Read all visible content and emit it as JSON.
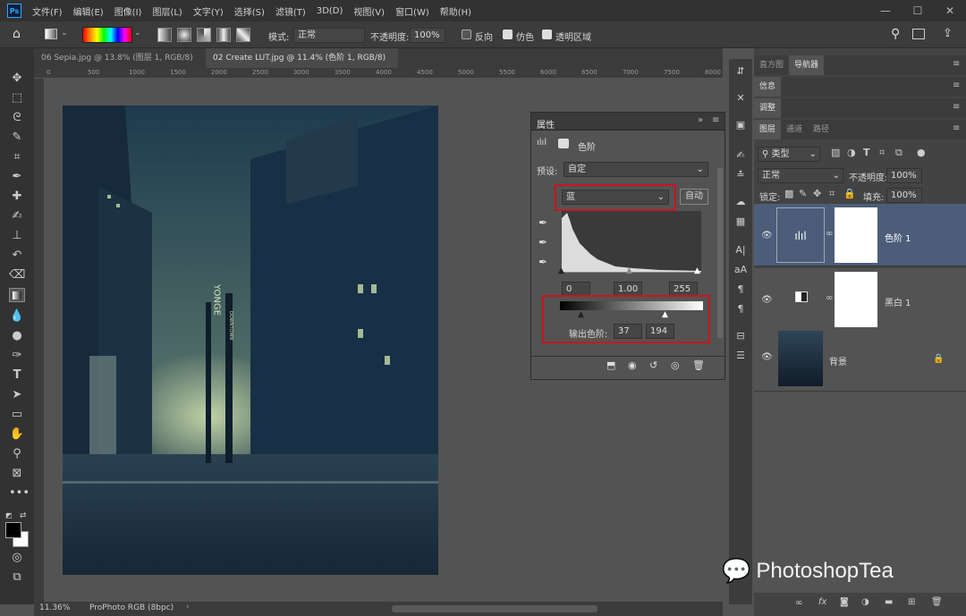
{
  "menu": [
    "文件(F)",
    "编辑(E)",
    "图像(I)",
    "图层(L)",
    "文字(Y)",
    "选择(S)",
    "滤镜(T)",
    "3D(D)",
    "视图(V)",
    "窗口(W)",
    "帮助(H)"
  ],
  "window_controls": {
    "min": "—",
    "max": "☐",
    "close": "✕"
  },
  "options": {
    "mode_label": "模式:",
    "mode_value": "正常",
    "opacity_label": "不透明度:",
    "opacity_value": "100%",
    "reverse_label": "反向",
    "dither_label": "仿色",
    "transparency_label": "透明区域"
  },
  "tabs": [
    {
      "label": "06 Sepia.jpg @ 13.8% (图层 1, RGB/8) *",
      "active": false
    },
    {
      "label": "02 Create LUT.jpg @ 11.4% (色阶 1, RGB/8) *",
      "active": true
    }
  ],
  "ruler_ticks": [
    "0",
    "500",
    "1000",
    "1500",
    "2000",
    "2500",
    "3000",
    "3500",
    "4000",
    "4500",
    "5000",
    "5500",
    "6000",
    "6500",
    "7000",
    "7500",
    "8000"
  ],
  "status": {
    "zoom": "11.36%",
    "profile": "ProPhoto RGB (8bpc)"
  },
  "properties": {
    "title": "属性",
    "panel_name": "色阶",
    "preset_label": "预设:",
    "preset_value": "自定",
    "channel_value": "蓝",
    "auto_label": "自动",
    "input_black": "0",
    "input_gamma": "1.00",
    "input_white": "255",
    "output_label": "输出色阶:",
    "output_black": "37",
    "output_white": "194"
  },
  "right_panels": {
    "tab_histogram": "直方图",
    "tab_navigator": "导航器",
    "info": "信息",
    "adjustments": "调整",
    "tab_layers": "图层",
    "tab_channels": "通道",
    "tab_paths": "路径",
    "filter_kind": "类型",
    "blend_mode": "正常",
    "opacity_label": "不透明度:",
    "opacity_value": "100%",
    "lock_label": "锁定:",
    "fill_label": "填充:",
    "fill_value": "100%"
  },
  "layers": [
    {
      "name": "色阶 1",
      "selected": true
    },
    {
      "name": "黑白 1",
      "selected": false
    },
    {
      "name": "背景",
      "selected": false
    }
  ],
  "watermark": "PhotoshopTea",
  "photo_signs": [
    "YONGE",
    "DOWNTOWN"
  ]
}
